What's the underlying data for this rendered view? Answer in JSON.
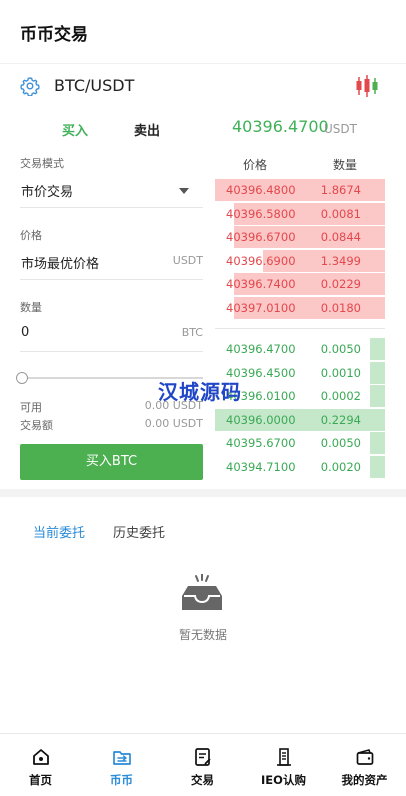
{
  "header": {
    "title": "币币交易"
  },
  "pair": {
    "name": "BTC/USDT",
    "settings_icon": "gear-icon",
    "chart_icon": "candlestick-icon"
  },
  "side_tabs": {
    "buy": "买入",
    "sell": "卖出"
  },
  "ticker": {
    "last_price": "40396.4700",
    "unit": "USDT"
  },
  "form": {
    "mode_label": "交易模式",
    "mode_value": "市价交易",
    "price_label": "价格",
    "price_value": "市场最优价格",
    "price_unit": "USDT",
    "qty_label": "数量",
    "qty_value": "0",
    "qty_unit": "BTC",
    "slider_fraction": 0,
    "available_label": "可用",
    "available_value": "0.00 USDT",
    "amount_label": "交易额",
    "amount_value": "0.00 USDT",
    "submit_label": "买入BTC"
  },
  "order_book": {
    "price_header": "价格",
    "qty_header": "数量",
    "asks": [
      {
        "price": "40396.4800",
        "qty": "1.8674",
        "depth": 1.0
      },
      {
        "price": "40396.5800",
        "qty": "0.0081",
        "depth": 0.89
      },
      {
        "price": "40396.6700",
        "qty": "0.0844",
        "depth": 0.89
      },
      {
        "price": "40396.6900",
        "qty": "1.3499",
        "depth": 0.72
      },
      {
        "price": "40396.7400",
        "qty": "0.0229",
        "depth": 0.89
      },
      {
        "price": "40397.0100",
        "qty": "0.0180",
        "depth": 0.89
      }
    ],
    "bids": [
      {
        "price": "40396.4700",
        "qty": "0.0050",
        "depth": 0.09
      },
      {
        "price": "40396.4500",
        "qty": "0.0010",
        "depth": 0.09
      },
      {
        "price": "40396.0100",
        "qty": "0.0002",
        "depth": 0.09
      },
      {
        "price": "40396.0000",
        "qty": "0.2294",
        "depth": 1.0
      },
      {
        "price": "40395.6700",
        "qty": "0.0050",
        "depth": 0.09
      },
      {
        "price": "40394.7100",
        "qty": "0.0020",
        "depth": 0.09
      }
    ]
  },
  "watermark": "汉城源码",
  "orders": {
    "current_tab": "当前委托",
    "history_tab": "历史委托",
    "empty_text": "暂无数据",
    "empty_icon": "empty-inbox-icon"
  },
  "colors": {
    "buy": "#4caf50",
    "sell": "#e3484d",
    "accent": "#2a8bd8"
  },
  "tabbar": [
    {
      "label": "首页",
      "icon": "home-icon",
      "active": false
    },
    {
      "label": "币币",
      "icon": "exchange-icon",
      "active": true
    },
    {
      "label": "交易",
      "icon": "trade-icon",
      "active": false
    },
    {
      "label": "IEO认购",
      "icon": "ieo-icon",
      "active": false
    },
    {
      "label": "我的资产",
      "icon": "wallet-icon",
      "active": false
    }
  ]
}
